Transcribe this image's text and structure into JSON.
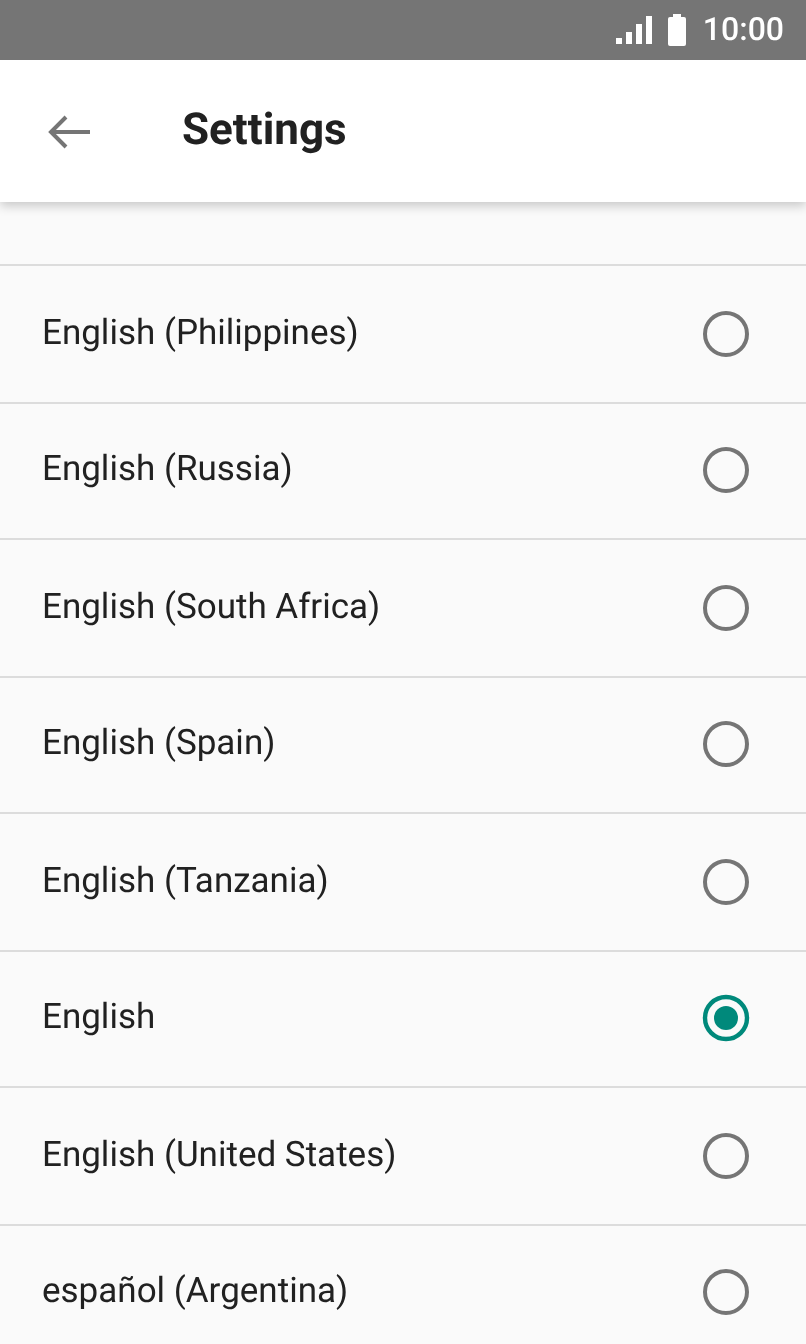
{
  "status_bar": {
    "time": "10:00"
  },
  "app_bar": {
    "title": "Settings"
  },
  "languages": [
    {
      "label": "English (Philippines)",
      "selected": false
    },
    {
      "label": "English (Russia)",
      "selected": false
    },
    {
      "label": "English (South Africa)",
      "selected": false
    },
    {
      "label": "English (Spain)",
      "selected": false
    },
    {
      "label": "English (Tanzania)",
      "selected": false
    },
    {
      "label": "English",
      "selected": true
    },
    {
      "label": "English (United States)",
      "selected": false
    },
    {
      "label": "español (Argentina)",
      "selected": false
    }
  ]
}
